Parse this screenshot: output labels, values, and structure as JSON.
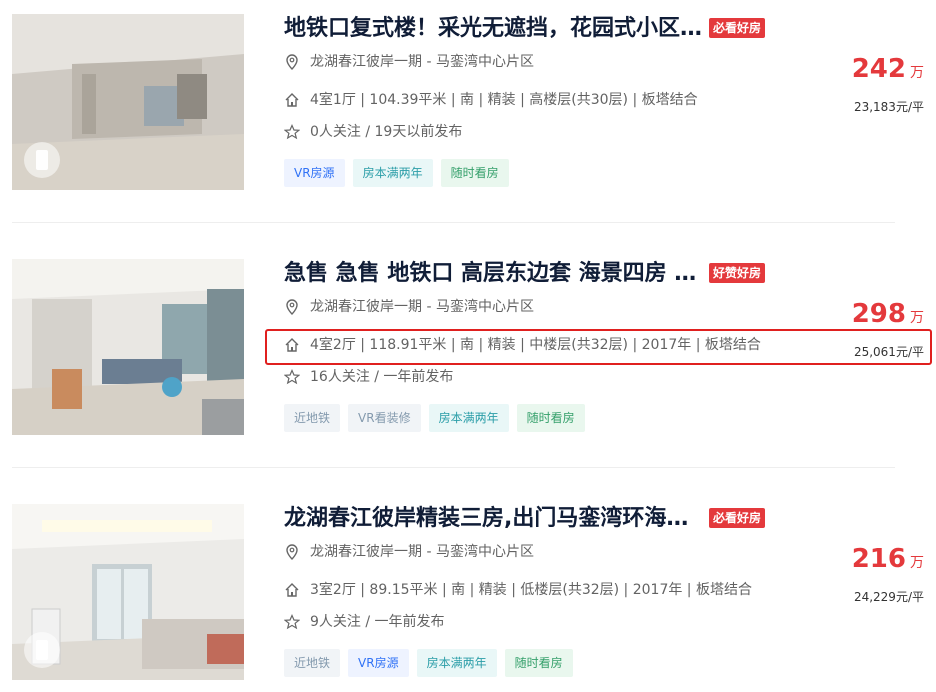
{
  "listings": [
    {
      "title": "地铁口复式楼！采光无遮挡，花园式小区…",
      "badge": "必看好房",
      "location": "龙湖春江彼岸一期 - 马銮湾中心片区",
      "house_info": "4室1厅 | 104.39平米 | 南 | 精装 | 高楼层(共30层) | 板塔结合",
      "follow_info": "0人关注 / 19天以前发布",
      "tags": [
        "VR房源",
        "房本满两年",
        "随时看房"
      ],
      "price": "242",
      "price_unit": "万",
      "unit_price": "23,183元/平"
    },
    {
      "title": "急售 急售 地铁口 高层东边套 海景四房 …",
      "badge": "好赞好房",
      "location": "龙湖春江彼岸一期 - 马銮湾中心片区",
      "house_info": "4室2厅 | 118.91平米 | 南 | 精装 | 中楼层(共32层) | 2017年 | 板塔结合",
      "follow_info": "16人关注 / 一年前发布",
      "tags": [
        "近地铁",
        "VR看装修",
        "房本满两年",
        "随时看房"
      ],
      "price": "298",
      "price_unit": "万",
      "unit_price": "25,061元/平"
    },
    {
      "title": "龙湖春江彼岸精装三房,出门马銮湾环海…",
      "badge": "必看好房",
      "location": "龙湖春江彼岸一期 - 马銮湾中心片区",
      "house_info": "3室2厅 | 89.15平米 | 南 | 精装 | 低楼层(共32层) | 2017年 | 板塔结合",
      "follow_info": "9人关注 / 一年前发布",
      "tags": [
        "近地铁",
        "VR房源",
        "房本满两年",
        "随时看房"
      ],
      "price": "216",
      "price_unit": "万",
      "unit_price": "24,229元/平"
    }
  ],
  "icons": {
    "location": "map-pin-icon",
    "house": "house-icon",
    "follow": "star-icon",
    "vr": "vr-icon"
  },
  "colors": {
    "accent_red": "#e4393c",
    "highlight": "#e0201f",
    "title": "#101d37"
  }
}
